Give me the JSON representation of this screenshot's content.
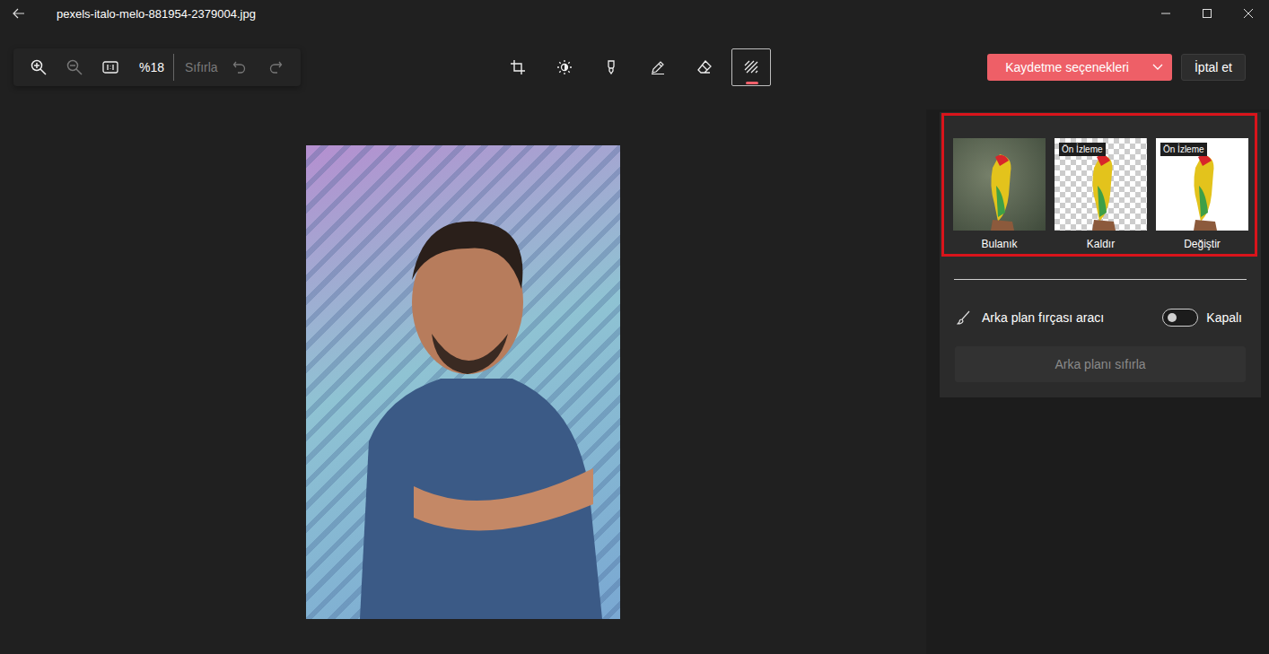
{
  "window": {
    "title": "pexels-italo-melo-881954-2379004.jpg"
  },
  "toolbar": {
    "zoom": "%18",
    "zoom_out_disabled": true,
    "reset": {
      "label": "Sıfırla",
      "disabled": true
    },
    "undo_disabled": true,
    "redo_disabled": true
  },
  "tools": [
    {
      "kind": "crop",
      "selected": false
    },
    {
      "kind": "adjust",
      "selected": false
    },
    {
      "kind": "filter",
      "selected": false
    },
    {
      "kind": "markup",
      "selected": false
    },
    {
      "kind": "erase",
      "selected": false
    },
    {
      "kind": "background",
      "selected": true
    }
  ],
  "save_button": {
    "label": "Kaydetme seçenekleri"
  },
  "cancel_button": {
    "label": "İptal et"
  },
  "background_options": [
    {
      "label": "Bulanık",
      "badge": null,
      "kind": "blur",
      "selected": false
    },
    {
      "label": "Kaldır",
      "badge": "Ön İzleme",
      "kind": "remove",
      "selected": false
    },
    {
      "label": "Değiştir",
      "badge": "Ön İzleme",
      "kind": "replace",
      "selected": false
    }
  ],
  "brush_tool": {
    "label": "Arka plan fırçası aracı",
    "on": false,
    "state_label": "Kapalı"
  },
  "reset_background": {
    "label": "Arka planı sıfırla",
    "disabled": true
  }
}
